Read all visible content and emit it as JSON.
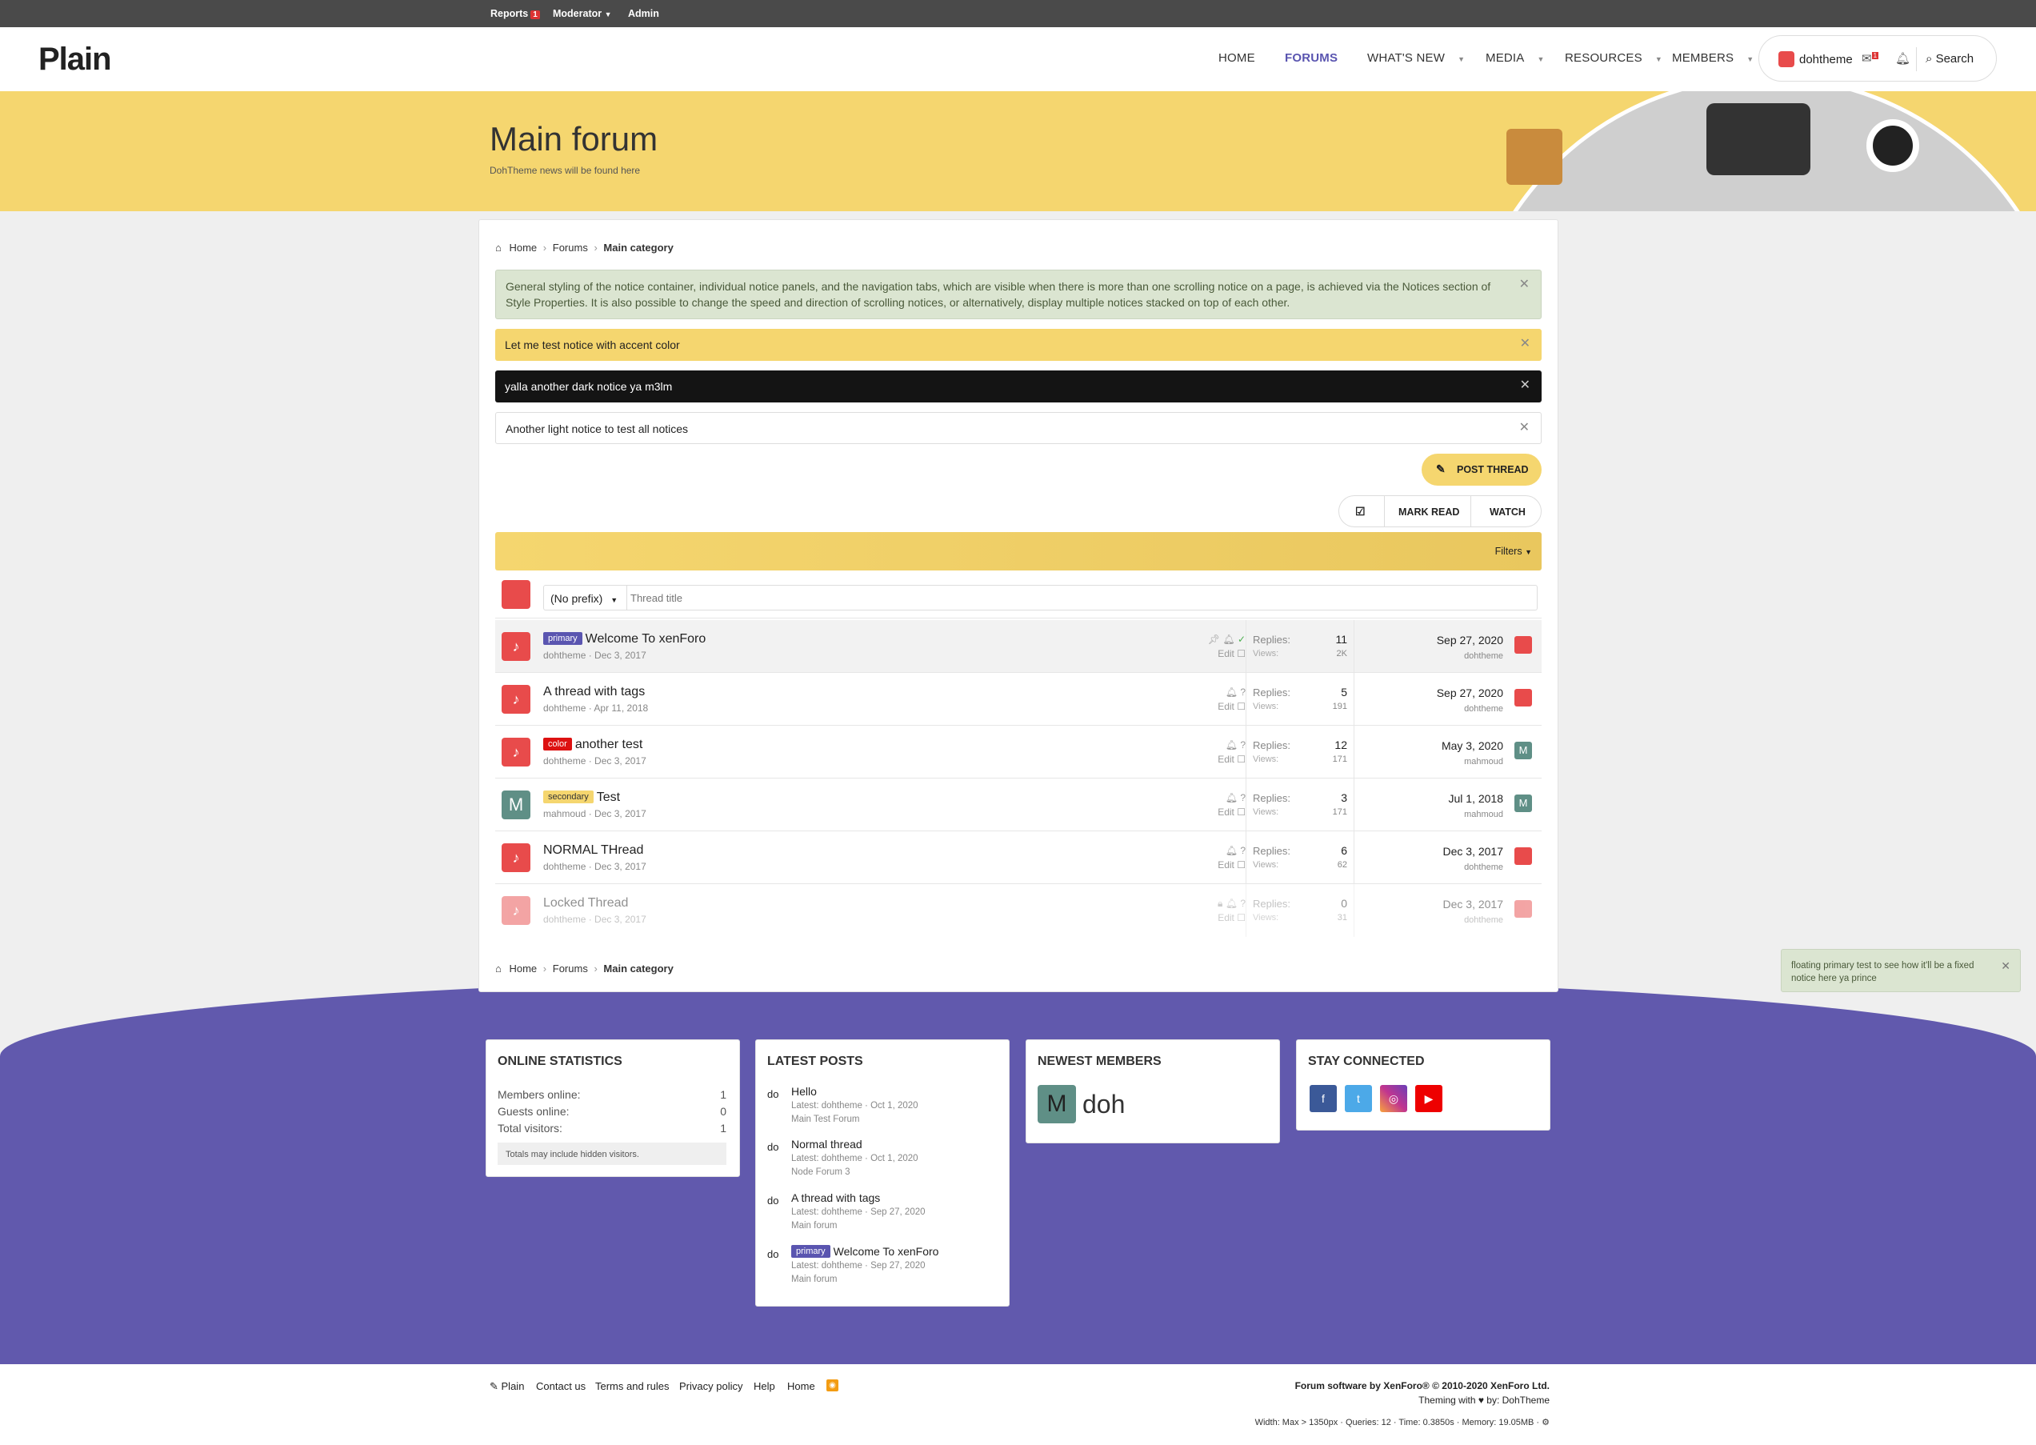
{
  "staffbar": {
    "reports": "Reports",
    "reports_count": "1",
    "moderator": "Moderator",
    "admin": "Admin"
  },
  "header": {
    "logo": "Plain",
    "nav": [
      {
        "label": "HOME"
      },
      {
        "label": "FORUMS"
      },
      {
        "label": "WHAT'S NEW"
      },
      {
        "label": "MEDIA"
      },
      {
        "label": "RESOURCES"
      },
      {
        "label": "MEMBERS"
      }
    ],
    "username": "dohtheme",
    "inbox_count": "1",
    "search": "Search"
  },
  "hero": {
    "title": "Main forum",
    "subtitle": "DohTheme news will be found here"
  },
  "breadcrumb": {
    "home": "Home",
    "forums": "Forums",
    "current": "Main category"
  },
  "notices": [
    {
      "text": "General styling of the notice container, individual notice panels, and the navigation tabs, which are visible when there is more than one scrolling notice on a page, is achieved via the Notices section of Style Properties. It is also possible to change the speed and direction of scrolling notices, or alternatively, display multiple notices stacked on top of each other."
    },
    {
      "text": "Let me test notice with accent color"
    },
    {
      "text": "yalla another dark notice ya m3lm"
    },
    {
      "text": "Another light notice to test all notices"
    }
  ],
  "actions": {
    "post_thread": "POST THREAD",
    "mark_read": "MARK READ",
    "watch": "WATCH",
    "filters": "Filters"
  },
  "quick_thread": {
    "prefix": "(No prefix)",
    "placeholder": "Thread title"
  },
  "threads": [
    {
      "prefix": "primary",
      "title": "Welcome To xenForo",
      "author": "dohtheme",
      "date": "Dec 3, 2017",
      "edit": "Edit",
      "replies_label": "Replies:",
      "replies": "11",
      "views_label": "Views:",
      "views": "2K",
      "last_date": "Sep 27, 2020",
      "last_user": "dohtheme"
    },
    {
      "prefix": "",
      "title": "A thread with tags",
      "author": "dohtheme",
      "date": "Apr 11, 2018",
      "edit": "Edit",
      "replies_label": "Replies:",
      "replies": "5",
      "views_label": "Views:",
      "views": "191",
      "last_date": "Sep 27, 2020",
      "last_user": "dohtheme"
    },
    {
      "prefix": "color",
      "title": "another test",
      "author": "dohtheme",
      "date": "Dec 3, 2017",
      "edit": "Edit",
      "replies_label": "Replies:",
      "replies": "12",
      "views_label": "Views:",
      "views": "171",
      "last_date": "May 3, 2020",
      "last_user": "mahmoud"
    },
    {
      "prefix": "secondary",
      "title": "Test",
      "author": "mahmoud",
      "date": "Dec 3, 2017",
      "edit": "Edit",
      "replies_label": "Replies:",
      "replies": "3",
      "views_label": "Views:",
      "views": "171",
      "last_date": "Jul 1, 2018",
      "last_user": "mahmoud"
    },
    {
      "prefix": "",
      "title": "NORMAL THread",
      "author": "dohtheme",
      "date": "Dec 3, 2017",
      "edit": "Edit",
      "replies_label": "Replies:",
      "replies": "6",
      "views_label": "Views:",
      "views": "62",
      "last_date": "Dec 3, 2017",
      "last_user": "dohtheme"
    },
    {
      "prefix": "",
      "title": "Locked Thread",
      "author": "dohtheme",
      "date": "Dec 3, 2017",
      "edit": "Edit",
      "replies_label": "Replies:",
      "replies": "0",
      "views_label": "Views:",
      "views": "31",
      "last_date": "Dec 3, 2017",
      "last_user": "dohtheme"
    }
  ],
  "avatar_letter": "M",
  "widgets": {
    "online": {
      "title": "ONLINE STATISTICS",
      "members_label": "Members online:",
      "members": "1",
      "guests_label": "Guests online:",
      "guests": "0",
      "total_label": "Total visitors:",
      "total": "1",
      "note": "Totals may include hidden visitors."
    },
    "latest": {
      "title": "LATEST POSTS",
      "posts": [
        {
          "avatar": "do",
          "prefix": "",
          "title": "Hello",
          "sub": "Latest: dohtheme · Oct 1, 2020",
          "forum": "Main Test Forum"
        },
        {
          "avatar": "do",
          "prefix": "",
          "title": "Normal thread",
          "sub": "Latest: dohtheme · Oct 1, 2020",
          "forum": "Node Forum 3"
        },
        {
          "avatar": "do",
          "prefix": "",
          "title": "A thread with tags",
          "sub": "Latest: dohtheme · Sep 27, 2020",
          "forum": "Main forum"
        },
        {
          "avatar": "do",
          "prefix": "primary",
          "title": "Welcome To xenForo",
          "sub": "Latest: dohtheme · Sep 27, 2020",
          "forum": "Main forum"
        }
      ]
    },
    "newest": {
      "title": "NEWEST MEMBERS",
      "member_avatar": "M",
      "member_name": "doh"
    },
    "connected": {
      "title": "STAY CONNECTED"
    }
  },
  "floating_notice": "floating primary test to see how it'll be a fixed notice here ya prince",
  "footer": {
    "links": [
      "Plain",
      "Contact us",
      "Terms and rules",
      "Privacy policy",
      "Help",
      "Home"
    ],
    "software": "Forum software by XenForo® © 2010-2020 XenForo Ltd.",
    "theming": "Theming with ♥ by: DohTheme",
    "debug": "Width: Max > 1350px · Queries: 12 · Time: 0.3850s · Memory: 19.05MB · ⚙"
  },
  "colors": {
    "accent": "#f5d66f",
    "primary": "#6159ad",
    "brand_red": "#e84b4b"
  }
}
